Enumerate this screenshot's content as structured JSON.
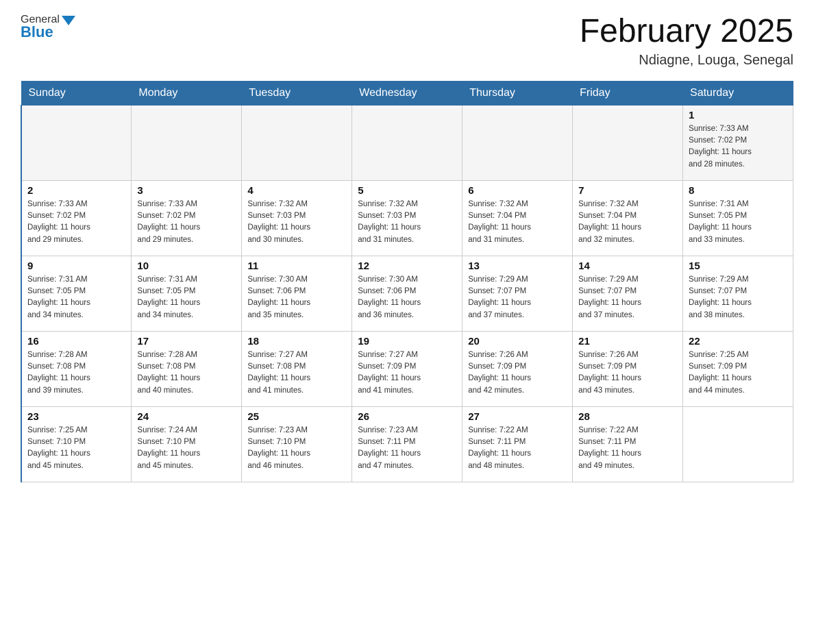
{
  "header": {
    "logo": {
      "general": "General",
      "blue": "Blue"
    },
    "title": "February 2025",
    "location": "Ndiagne, Louga, Senegal"
  },
  "days_of_week": [
    "Sunday",
    "Monday",
    "Tuesday",
    "Wednesday",
    "Thursday",
    "Friday",
    "Saturday"
  ],
  "weeks": [
    {
      "cells": [
        {
          "day": null,
          "info": null
        },
        {
          "day": null,
          "info": null
        },
        {
          "day": null,
          "info": null
        },
        {
          "day": null,
          "info": null
        },
        {
          "day": null,
          "info": null
        },
        {
          "day": null,
          "info": null
        },
        {
          "day": "1",
          "info": "Sunrise: 7:33 AM\nSunset: 7:02 PM\nDaylight: 11 hours\nand 28 minutes."
        }
      ]
    },
    {
      "cells": [
        {
          "day": "2",
          "info": "Sunrise: 7:33 AM\nSunset: 7:02 PM\nDaylight: 11 hours\nand 29 minutes."
        },
        {
          "day": "3",
          "info": "Sunrise: 7:33 AM\nSunset: 7:02 PM\nDaylight: 11 hours\nand 29 minutes."
        },
        {
          "day": "4",
          "info": "Sunrise: 7:32 AM\nSunset: 7:03 PM\nDaylight: 11 hours\nand 30 minutes."
        },
        {
          "day": "5",
          "info": "Sunrise: 7:32 AM\nSunset: 7:03 PM\nDaylight: 11 hours\nand 31 minutes."
        },
        {
          "day": "6",
          "info": "Sunrise: 7:32 AM\nSunset: 7:04 PM\nDaylight: 11 hours\nand 31 minutes."
        },
        {
          "day": "7",
          "info": "Sunrise: 7:32 AM\nSunset: 7:04 PM\nDaylight: 11 hours\nand 32 minutes."
        },
        {
          "day": "8",
          "info": "Sunrise: 7:31 AM\nSunset: 7:05 PM\nDaylight: 11 hours\nand 33 minutes."
        }
      ]
    },
    {
      "cells": [
        {
          "day": "9",
          "info": "Sunrise: 7:31 AM\nSunset: 7:05 PM\nDaylight: 11 hours\nand 34 minutes."
        },
        {
          "day": "10",
          "info": "Sunrise: 7:31 AM\nSunset: 7:05 PM\nDaylight: 11 hours\nand 34 minutes."
        },
        {
          "day": "11",
          "info": "Sunrise: 7:30 AM\nSunset: 7:06 PM\nDaylight: 11 hours\nand 35 minutes."
        },
        {
          "day": "12",
          "info": "Sunrise: 7:30 AM\nSunset: 7:06 PM\nDaylight: 11 hours\nand 36 minutes."
        },
        {
          "day": "13",
          "info": "Sunrise: 7:29 AM\nSunset: 7:07 PM\nDaylight: 11 hours\nand 37 minutes."
        },
        {
          "day": "14",
          "info": "Sunrise: 7:29 AM\nSunset: 7:07 PM\nDaylight: 11 hours\nand 37 minutes."
        },
        {
          "day": "15",
          "info": "Sunrise: 7:29 AM\nSunset: 7:07 PM\nDaylight: 11 hours\nand 38 minutes."
        }
      ]
    },
    {
      "cells": [
        {
          "day": "16",
          "info": "Sunrise: 7:28 AM\nSunset: 7:08 PM\nDaylight: 11 hours\nand 39 minutes."
        },
        {
          "day": "17",
          "info": "Sunrise: 7:28 AM\nSunset: 7:08 PM\nDaylight: 11 hours\nand 40 minutes."
        },
        {
          "day": "18",
          "info": "Sunrise: 7:27 AM\nSunset: 7:08 PM\nDaylight: 11 hours\nand 41 minutes."
        },
        {
          "day": "19",
          "info": "Sunrise: 7:27 AM\nSunset: 7:09 PM\nDaylight: 11 hours\nand 41 minutes."
        },
        {
          "day": "20",
          "info": "Sunrise: 7:26 AM\nSunset: 7:09 PM\nDaylight: 11 hours\nand 42 minutes."
        },
        {
          "day": "21",
          "info": "Sunrise: 7:26 AM\nSunset: 7:09 PM\nDaylight: 11 hours\nand 43 minutes."
        },
        {
          "day": "22",
          "info": "Sunrise: 7:25 AM\nSunset: 7:09 PM\nDaylight: 11 hours\nand 44 minutes."
        }
      ]
    },
    {
      "cells": [
        {
          "day": "23",
          "info": "Sunrise: 7:25 AM\nSunset: 7:10 PM\nDaylight: 11 hours\nand 45 minutes."
        },
        {
          "day": "24",
          "info": "Sunrise: 7:24 AM\nSunset: 7:10 PM\nDaylight: 11 hours\nand 45 minutes."
        },
        {
          "day": "25",
          "info": "Sunrise: 7:23 AM\nSunset: 7:10 PM\nDaylight: 11 hours\nand 46 minutes."
        },
        {
          "day": "26",
          "info": "Sunrise: 7:23 AM\nSunset: 7:11 PM\nDaylight: 11 hours\nand 47 minutes."
        },
        {
          "day": "27",
          "info": "Sunrise: 7:22 AM\nSunset: 7:11 PM\nDaylight: 11 hours\nand 48 minutes."
        },
        {
          "day": "28",
          "info": "Sunrise: 7:22 AM\nSunset: 7:11 PM\nDaylight: 11 hours\nand 49 minutes."
        },
        {
          "day": null,
          "info": null
        }
      ]
    }
  ]
}
